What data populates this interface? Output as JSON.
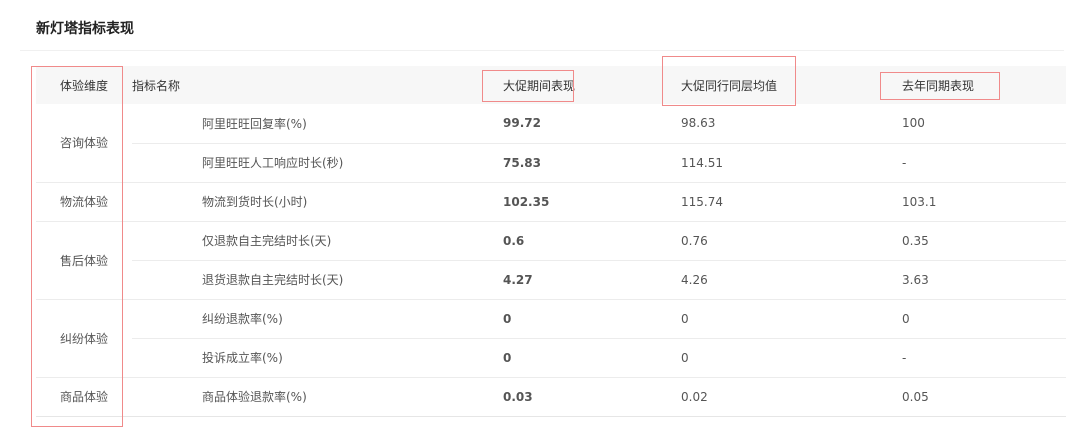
{
  "page_title": "新灯塔指标表现",
  "columns": {
    "dimension": "体验维度",
    "metric": "指标名称",
    "current": "大促期间表现",
    "peer_avg": "大促同行同层均值",
    "last_year": "去年同期表现"
  },
  "groups": [
    {
      "dimension": "咨询体验",
      "rows": [
        {
          "metric": "阿里旺旺回复率(%)",
          "current": "99.72",
          "peer_avg": "98.63",
          "last_year": "100"
        },
        {
          "metric": "阿里旺旺人工响应时长(秒)",
          "current": "75.83",
          "peer_avg": "114.51",
          "last_year": "-"
        }
      ]
    },
    {
      "dimension": "物流体验",
      "rows": [
        {
          "metric": "物流到货时长(小时)",
          "current": "102.35",
          "peer_avg": "115.74",
          "last_year": "103.1"
        }
      ]
    },
    {
      "dimension": "售后体验",
      "rows": [
        {
          "metric": "仅退款自主完结时长(天)",
          "current": "0.6",
          "peer_avg": "0.76",
          "last_year": "0.35"
        },
        {
          "metric": "退货退款自主完结时长(天)",
          "current": "4.27",
          "peer_avg": "4.26",
          "last_year": "3.63"
        }
      ]
    },
    {
      "dimension": "纠纷体验",
      "rows": [
        {
          "metric": "纠纷退款率(%)",
          "current": "0",
          "peer_avg": "0",
          "last_year": "0"
        },
        {
          "metric": "投诉成立率(%)",
          "current": "0",
          "peer_avg": "0",
          "last_year": "-"
        }
      ]
    },
    {
      "dimension": "商品体验",
      "rows": [
        {
          "metric": "商品体验退款率(%)",
          "current": "0.03",
          "peer_avg": "0.02",
          "last_year": "0.05"
        }
      ]
    }
  ],
  "highlight_color": "#f08a8a"
}
